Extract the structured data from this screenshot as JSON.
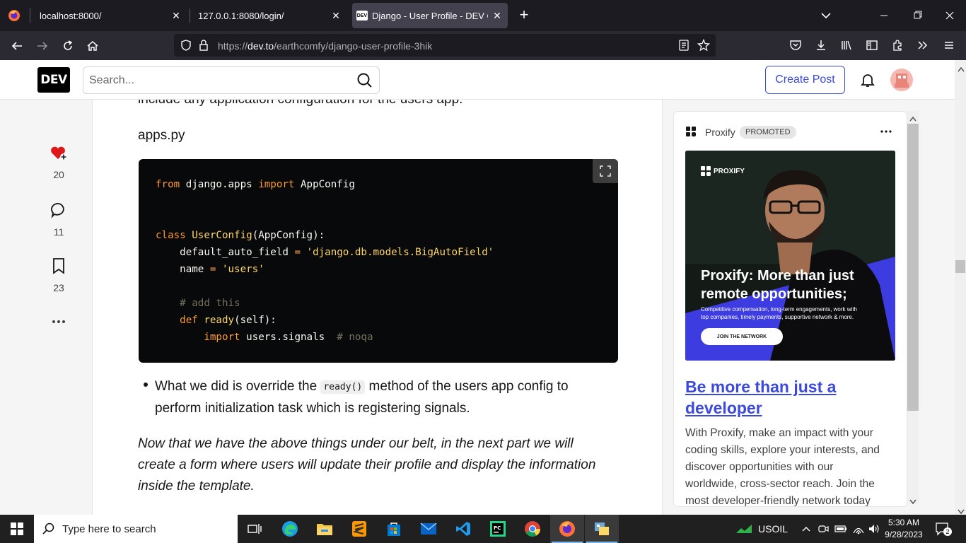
{
  "browser": {
    "tabs": [
      {
        "title": "localhost:8000/"
      },
      {
        "title": "127.0.0.1:8080/login/"
      },
      {
        "title": "Django - User Profile - DEV Con"
      }
    ],
    "url_prefix": "https://",
    "url_domain": "dev.to",
    "url_path": "/earthcomfy/django-user-profile-3hik"
  },
  "header": {
    "logo": "DEV",
    "search_placeholder": "Search...",
    "create_post": "Create Post"
  },
  "reactions": [
    {
      "icon": "heart-plus-icon",
      "count": "20"
    },
    {
      "icon": "comment-icon",
      "count": "11"
    },
    {
      "icon": "bookmark-icon",
      "count": "23"
    }
  ],
  "article": {
    "cut_line": "include any application configuration for the users app.",
    "file_label": "apps.py",
    "code": {
      "l1": {
        "a": "from",
        "b": " django.apps ",
        "c": "import",
        "d": " AppConfig"
      },
      "l2": {
        "a": "class",
        "b": " ",
        "c": "UserConfig",
        "d": "(AppConfig):"
      },
      "l3": {
        "a": "    default_auto_field ",
        "b": "=",
        "c": " ",
        "d": "'django.db.models.BigAutoField'"
      },
      "l4": {
        "a": "    name ",
        "b": "=",
        "c": " ",
        "d": "'users'"
      },
      "l5": {
        "a": "    # add this"
      },
      "l6": {
        "a": "    ",
        "b": "def",
        "c": " ",
        "d": "ready",
        "e": "(self):"
      },
      "l7": {
        "a": "        ",
        "b": "import",
        "c": " users.signals  ",
        "d": "# noqa"
      }
    },
    "bullet_pre": "What we did is override the ",
    "bullet_code": "ready()",
    "bullet_post": " method of the users app config to",
    "bullet_line2": "perform initialization task which is registering signals.",
    "italic_l1": "Now that we have the above things under our belt, in the next part we will",
    "italic_l2": "create a form where users will update their profile and display the information",
    "italic_l3": "inside the template."
  },
  "ad": {
    "brand": "Proxify",
    "badge": "PROMOTED",
    "img_logo": "PROXIFY",
    "img_headline_1": "Proxify: More than just",
    "img_headline_2": "remote opportunities;",
    "img_sub_1": "Competitive compensation, long-term engagements, work with",
    "img_sub_2": "top companies, timely payments, supportive network & more.",
    "img_cta": "JOIN THE NETWORK",
    "title_1": "Be more than just a",
    "title_2": "developer",
    "body_1": "With Proxify, make an impact with your",
    "body_2": "coding skills, explore your interests, and",
    "body_3": "discover opportunities with our",
    "body_4": "worldwide, cross-sector reach. Join the",
    "body_5": "most developer-friendly network today"
  },
  "taskbar": {
    "search_placeholder": "Type here to search",
    "ticker": "USOIL",
    "time": "5:30 AM",
    "date": "9/28/2023",
    "notifications": "2"
  },
  "colors": {
    "accent": "#3b49df",
    "heart": "#dc1818"
  }
}
